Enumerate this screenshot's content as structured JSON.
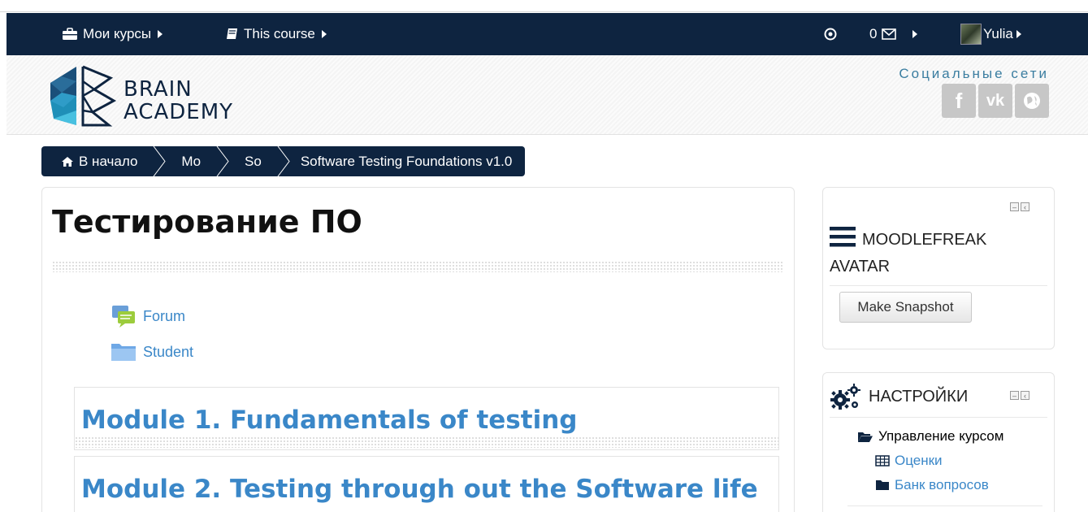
{
  "navbar": {
    "my_courses": "Мои курсы",
    "this_course": "This course",
    "messages_count": "0",
    "user_name": "Yulia"
  },
  "header": {
    "logo_line1": "BRAIN",
    "logo_line2": "ACADEMY",
    "social_title": "Социальные сети",
    "social": [
      "f",
      "vk",
      "globe"
    ]
  },
  "breadcrumb": {
    "home": "В начало",
    "items": [
      "Mo",
      "So",
      "Software Testing Foundations v1.0"
    ]
  },
  "course": {
    "title": "Тестирование ПО",
    "activities": [
      {
        "label": "Forum",
        "icon": "forum-icon"
      },
      {
        "label": "Student",
        "icon": "folder-icon"
      }
    ],
    "modules": [
      "Module 1. Fundamentals of testing",
      "Module 2. Testing through out the Software life"
    ]
  },
  "blocks": {
    "avatar": {
      "title_line1": "MOODLEFREAK",
      "title_line2": "AVATAR",
      "button": "Make Snapshot"
    },
    "settings": {
      "title": "НАСТРОЙКИ",
      "course_admin": "Управление курсом",
      "grades": "Оценки",
      "question_bank": "Банк вопросов"
    }
  },
  "colors": {
    "navbar": "#0e2440",
    "link": "#3a87c8",
    "social_title": "#3a7da0"
  }
}
